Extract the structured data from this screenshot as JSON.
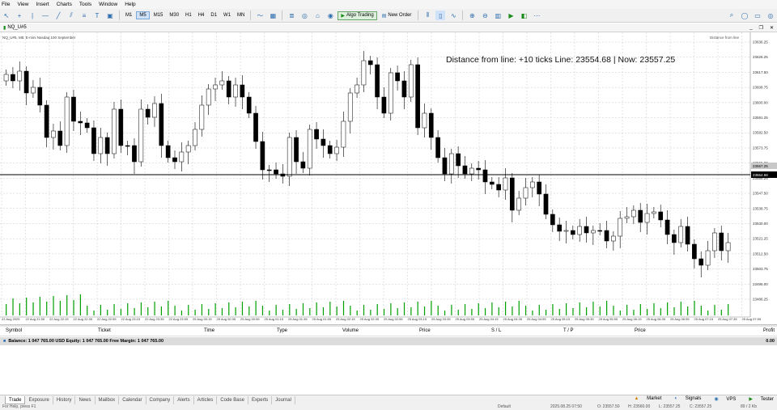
{
  "menu": [
    "File",
    "View",
    "Insert",
    "Charts",
    "Tools",
    "Window",
    "Help"
  ],
  "toolbar": {
    "timeframes": [
      "M1",
      "M5",
      "M15",
      "M30",
      "H1",
      "H4",
      "D1",
      "W1",
      "MN"
    ],
    "active_timeframe": "M5",
    "algo_trading": "Algo Trading",
    "new_order": "New Order"
  },
  "chart_tab": {
    "label": "NQ_U#5"
  },
  "chart": {
    "title_line": "NQ_U#5, M5: E-mini Nasdaq 100 September",
    "comment": "Distance from line: +10 ticks Line: 23554.68 | Now: 23557.25",
    "depth_label": "Distance from line",
    "price_labels": [
      "23636.25",
      "23626.25",
      "23617.50",
      "23608.75",
      "23600.00",
      "23591.25",
      "23582.50",
      "23573.75",
      "23565.00",
      "23556.25",
      "23547.50",
      "23538.75",
      "23530.00",
      "23521.25",
      "23512.50",
      "23503.75",
      "23495.00",
      "23486.25"
    ],
    "line_price_label": "23554.68",
    "current_price_label": "23557.25",
    "time_labels": [
      "22 Aug 2025",
      "22 Aug 21:55",
      "22 Aug 22:15",
      "22 Aug 22:35",
      "22 Aug 22:55",
      "22 Aug 23:15",
      "22 Aug 23:35",
      "22 Aug 23:55",
      "25 Aug 00:15",
      "25 Aug 00:35",
      "25 Aug 00:55",
      "25 Aug 01:15",
      "25 Aug 01:35",
      "25 Aug 01:55",
      "25 Aug 02:15",
      "25 Aug 02:35",
      "25 Aug 02:55",
      "25 Aug 03:15",
      "25 Aug 03:35",
      "25 Aug 03:55",
      "25 Aug 04:15",
      "25 Aug 04:35",
      "25 Aug 04:55",
      "25 Aug 05:15",
      "25 Aug 05:35",
      "25 Aug 05:55",
      "25 Aug 06:15",
      "25 Aug 06:35",
      "25 Aug 06:55",
      "25 Aug 07:15",
      "25 Aug 07:35",
      "25 Aug 07:55"
    ]
  },
  "terminal": {
    "columns": [
      "Symbol",
      "Ticket",
      "Time",
      "Type",
      "Volume",
      "Price",
      "S / L",
      "T / P",
      "Price",
      "Profit"
    ],
    "balance_text": "Balance: 1 047 765.00 USD  Equity: 1 047 765.00  Free Margin: 1 047 765.00",
    "profit_total": "0.00",
    "tabs": [
      "Trade",
      "Exposure",
      "History",
      "News",
      "Mailbox",
      "Calendar",
      "Company",
      "Alerts",
      "Articles",
      "Code Base",
      "Experts",
      "Journal"
    ],
    "active_tab": "Trade",
    "right_tabs": [
      "Market",
      "Signals",
      "VPS",
      "Tester"
    ]
  },
  "status": {
    "left": "For Help, press F1",
    "profile": "Default",
    "datetime": "2025.08.25 07:50",
    "o": "O: 23557.50",
    "h": "H: 23560.00",
    "l": "L: 23557.25",
    "c": "C: 23557.25",
    "size": "89 / 2 Kb"
  },
  "colors": {
    "bull": "#ffffff",
    "bear": "#000000",
    "volume": "#00a000",
    "grid": "#c8c8c8"
  }
}
